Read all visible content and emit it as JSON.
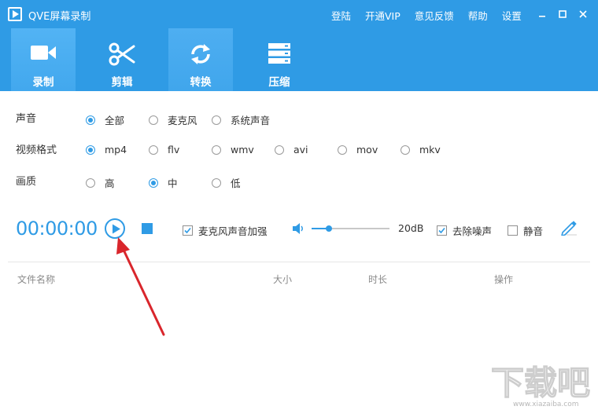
{
  "window": {
    "title": "QVE屏幕录制",
    "links": [
      "登陆",
      "开通VIP",
      "意见反馈",
      "帮助",
      "设置"
    ],
    "controls": [
      "minimize-icon",
      "maximize-icon",
      "close-icon"
    ]
  },
  "tabs": [
    {
      "label": "录制",
      "icon": "video-camera-icon",
      "state": "active"
    },
    {
      "label": "剪辑",
      "icon": "scissors-icon",
      "state": "normal"
    },
    {
      "label": "转换",
      "icon": "refresh-icon",
      "state": "hover"
    },
    {
      "label": "压缩",
      "icon": "server-stack-icon",
      "state": "normal"
    }
  ],
  "options": {
    "audio": {
      "label": "声音",
      "choices": [
        "全部",
        "麦克风",
        "系统声音"
      ],
      "selected": "全部"
    },
    "format": {
      "label": "视频格式",
      "choices": [
        "mp4",
        "flv",
        "wmv",
        "avi",
        "mov",
        "mkv"
      ],
      "selected": "mp4"
    },
    "quality": {
      "label": "画质",
      "choices": [
        "高",
        "中",
        "低"
      ],
      "selected": "中"
    }
  },
  "controls": {
    "timer": "00:00:00",
    "mic_boost": {
      "label": "麦克风声音加强",
      "checked": true
    },
    "volume": {
      "value_db": 20,
      "display": "20dB",
      "level": 0.22
    },
    "denoise": {
      "label": "去除噪声",
      "checked": true
    },
    "mute": {
      "label": "静音",
      "checked": false
    }
  },
  "file_list": {
    "columns": [
      "文件名称",
      "大小",
      "时长",
      "操作"
    ],
    "rows": []
  },
  "watermark": {
    "text": "下载吧",
    "url": "www.xiazaiba.com"
  },
  "colors": {
    "accent": "#2f9be5",
    "annotation": "#d9262c"
  }
}
